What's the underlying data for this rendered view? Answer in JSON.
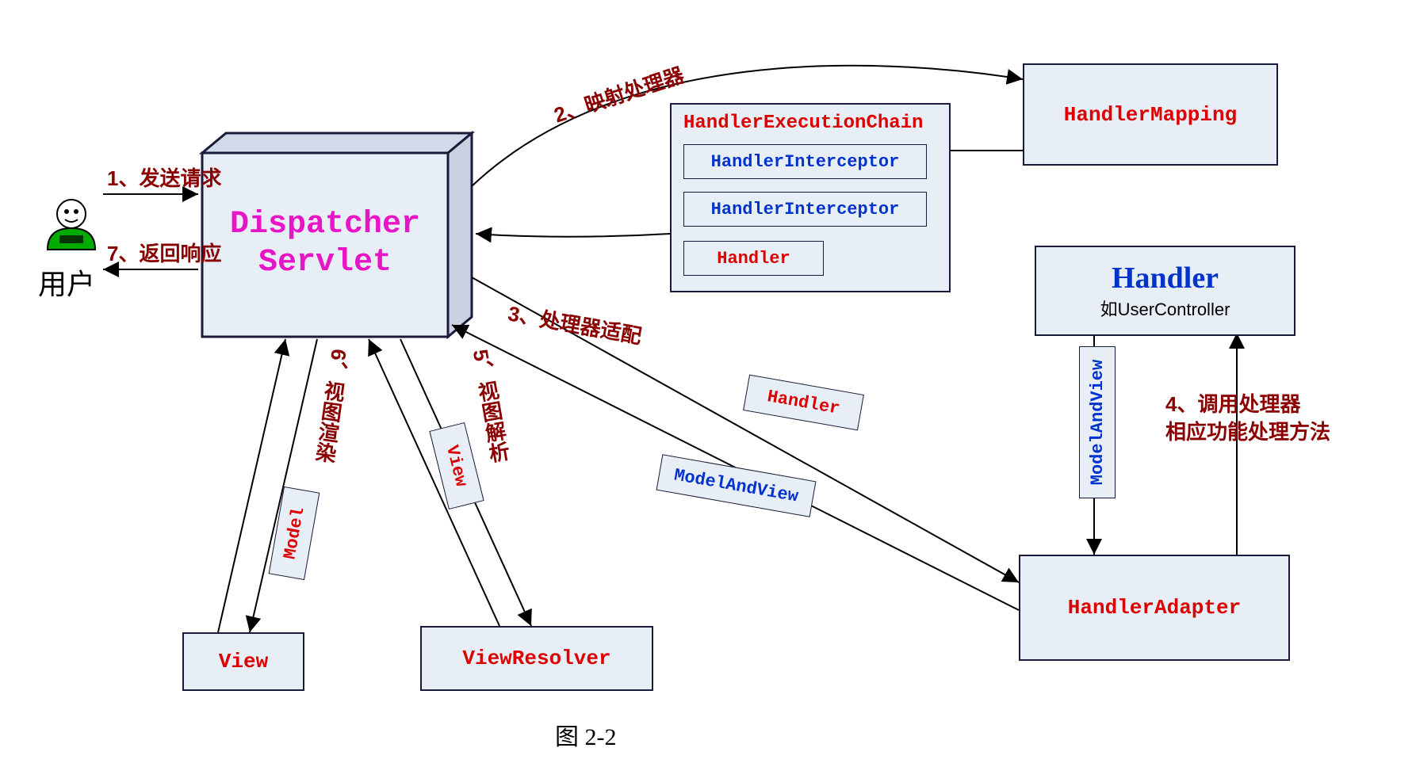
{
  "user_label": "用户",
  "dispatcher": "Dispatcher\nServlet",
  "handler_mapping": "HandlerMapping",
  "chain": {
    "title": "HandlerExecutionChain",
    "i1": "HandlerInterceptor",
    "i2": "HandlerInterceptor",
    "h": "Handler"
  },
  "handler_box": {
    "title": "Handler",
    "sub": "如UserController"
  },
  "handler_adapter": "HandlerAdapter",
  "view_resolver": "ViewResolver",
  "view": "View",
  "msg": {
    "handler": "Handler",
    "mav": "ModelAndView",
    "view": "View",
    "model": "Model",
    "mav2": "ModelAndView"
  },
  "steps": {
    "s1": "1、发送请求",
    "s2": "2、映射处理器",
    "s3": "3、处理器适配",
    "s4a": "4、调用处理器",
    "s4b": "相应功能处理方法",
    "s5": "5、视图解析",
    "s6": "6、视图渲染",
    "s7": "7、返回响应"
  },
  "caption": "图 2-2"
}
